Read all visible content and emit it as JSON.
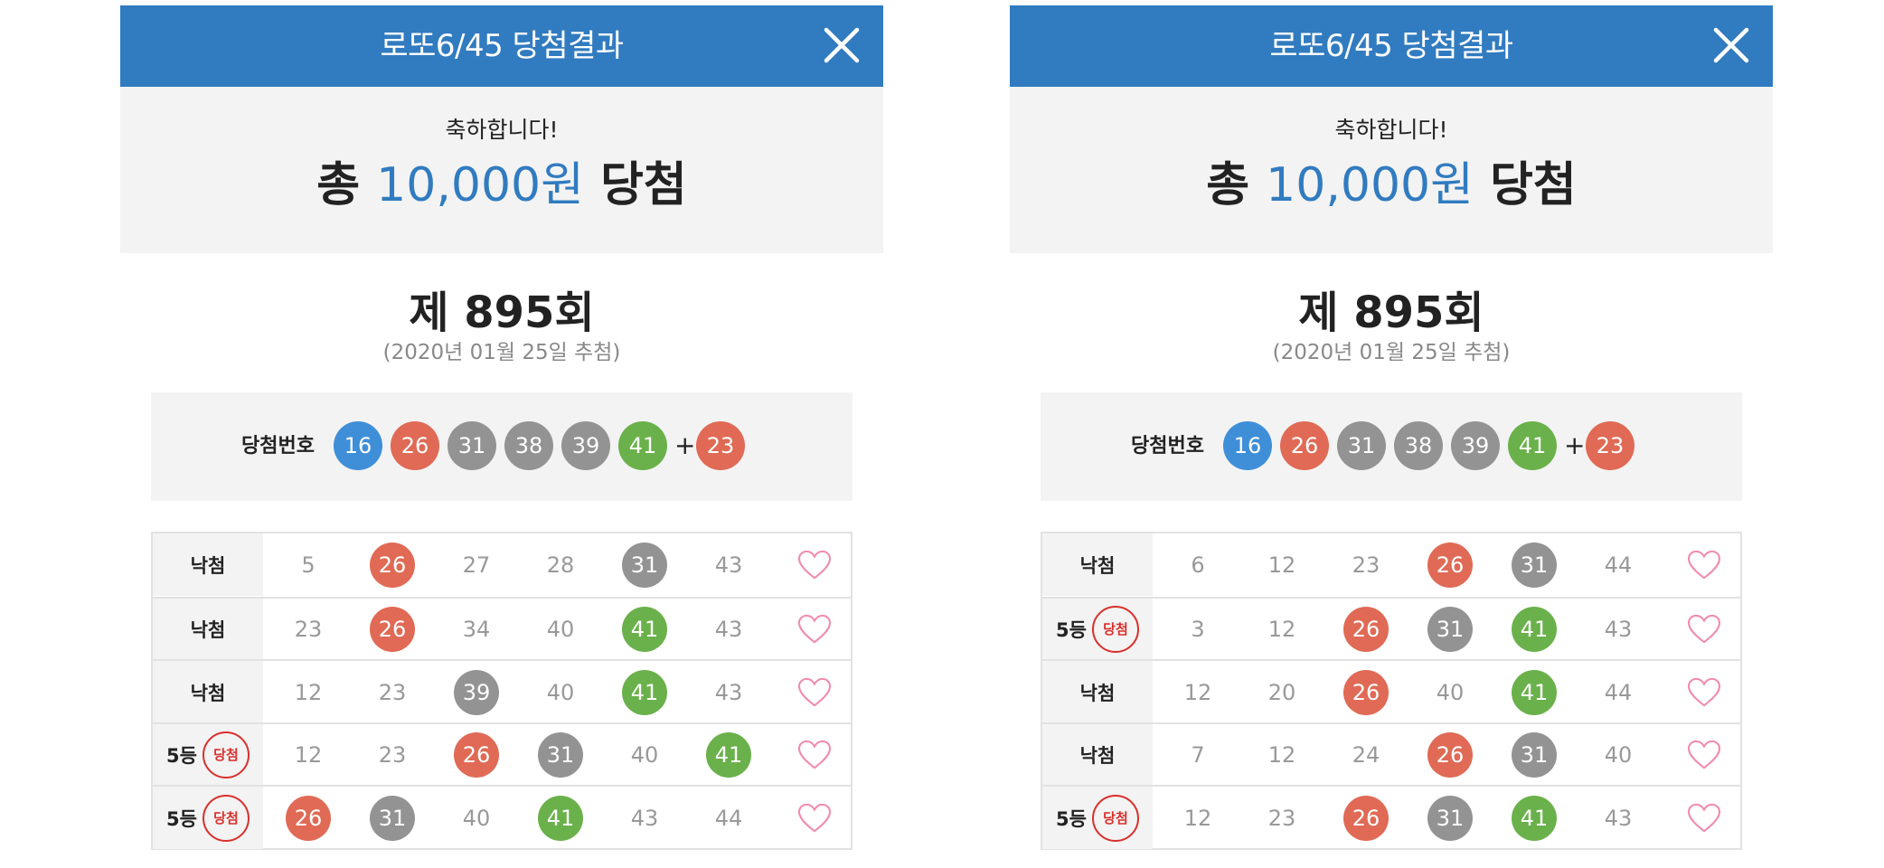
{
  "panels": [
    {
      "header_title": "로또6/45 당첨결과",
      "congrats": {
        "sub": "축하합니다!",
        "prefix": "총 ",
        "amount": "10,000원",
        "suffix": " 당첨"
      },
      "round": "제 895회",
      "draw_date": "(2020년 01월 25일 추첨)",
      "winning": {
        "label": "당첨번호",
        "numbers": [
          {
            "n": "16",
            "color": "blue"
          },
          {
            "n": "26",
            "color": "red"
          },
          {
            "n": "31",
            "color": "gray"
          },
          {
            "n": "38",
            "color": "gray"
          },
          {
            "n": "39",
            "color": "gray"
          },
          {
            "n": "41",
            "color": "green"
          }
        ],
        "plus": "+",
        "bonus": {
          "n": "23",
          "color": "red"
        }
      },
      "rows": [
        {
          "result": "낙첨",
          "rank": "",
          "badge": "",
          "numbers": [
            {
              "n": "5",
              "match": false
            },
            {
              "n": "26",
              "match": true,
              "color": "red"
            },
            {
              "n": "27",
              "match": false
            },
            {
              "n": "28",
              "match": false
            },
            {
              "n": "31",
              "match": true,
              "color": "gray"
            },
            {
              "n": "43",
              "match": false
            }
          ]
        },
        {
          "result": "낙첨",
          "rank": "",
          "badge": "",
          "numbers": [
            {
              "n": "23",
              "match": false
            },
            {
              "n": "26",
              "match": true,
              "color": "red"
            },
            {
              "n": "34",
              "match": false
            },
            {
              "n": "40",
              "match": false
            },
            {
              "n": "41",
              "match": true,
              "color": "green"
            },
            {
              "n": "43",
              "match": false
            }
          ]
        },
        {
          "result": "낙첨",
          "rank": "",
          "badge": "",
          "numbers": [
            {
              "n": "12",
              "match": false
            },
            {
              "n": "23",
              "match": false
            },
            {
              "n": "39",
              "match": true,
              "color": "gray"
            },
            {
              "n": "40",
              "match": false
            },
            {
              "n": "41",
              "match": true,
              "color": "green"
            },
            {
              "n": "43",
              "match": false
            }
          ]
        },
        {
          "result": "",
          "rank": "5등",
          "badge": "당첨",
          "numbers": [
            {
              "n": "12",
              "match": false
            },
            {
              "n": "23",
              "match": false
            },
            {
              "n": "26",
              "match": true,
              "color": "red"
            },
            {
              "n": "31",
              "match": true,
              "color": "gray"
            },
            {
              "n": "40",
              "match": false
            },
            {
              "n": "41",
              "match": true,
              "color": "green"
            }
          ]
        },
        {
          "result": "",
          "rank": "5등",
          "badge": "당첨",
          "numbers": [
            {
              "n": "26",
              "match": true,
              "color": "red"
            },
            {
              "n": "31",
              "match": true,
              "color": "gray"
            },
            {
              "n": "40",
              "match": false
            },
            {
              "n": "41",
              "match": true,
              "color": "green"
            },
            {
              "n": "43",
              "match": false
            },
            {
              "n": "44",
              "match": false
            }
          ]
        }
      ]
    },
    {
      "header_title": "로또6/45 당첨결과",
      "congrats": {
        "sub": "축하합니다!",
        "prefix": "총 ",
        "amount": "10,000원",
        "suffix": " 당첨"
      },
      "round": "제 895회",
      "draw_date": "(2020년 01월 25일 추첨)",
      "winning": {
        "label": "당첨번호",
        "numbers": [
          {
            "n": "16",
            "color": "blue"
          },
          {
            "n": "26",
            "color": "red"
          },
          {
            "n": "31",
            "color": "gray"
          },
          {
            "n": "38",
            "color": "gray"
          },
          {
            "n": "39",
            "color": "gray"
          },
          {
            "n": "41",
            "color": "green"
          }
        ],
        "plus": "+",
        "bonus": {
          "n": "23",
          "color": "red"
        }
      },
      "rows": [
        {
          "result": "낙첨",
          "rank": "",
          "badge": "",
          "numbers": [
            {
              "n": "6",
              "match": false
            },
            {
              "n": "12",
              "match": false
            },
            {
              "n": "23",
              "match": false
            },
            {
              "n": "26",
              "match": true,
              "color": "red"
            },
            {
              "n": "31",
              "match": true,
              "color": "gray"
            },
            {
              "n": "44",
              "match": false
            }
          ]
        },
        {
          "result": "",
          "rank": "5등",
          "badge": "당첨",
          "numbers": [
            {
              "n": "3",
              "match": false
            },
            {
              "n": "12",
              "match": false
            },
            {
              "n": "26",
              "match": true,
              "color": "red"
            },
            {
              "n": "31",
              "match": true,
              "color": "gray"
            },
            {
              "n": "41",
              "match": true,
              "color": "green"
            },
            {
              "n": "43",
              "match": false
            }
          ]
        },
        {
          "result": "낙첨",
          "rank": "",
          "badge": "",
          "numbers": [
            {
              "n": "12",
              "match": false
            },
            {
              "n": "20",
              "match": false
            },
            {
              "n": "26",
              "match": true,
              "color": "red"
            },
            {
              "n": "40",
              "match": false
            },
            {
              "n": "41",
              "match": true,
              "color": "green"
            },
            {
              "n": "44",
              "match": false
            }
          ]
        },
        {
          "result": "낙첨",
          "rank": "",
          "badge": "",
          "numbers": [
            {
              "n": "7",
              "match": false
            },
            {
              "n": "12",
              "match": false
            },
            {
              "n": "24",
              "match": false
            },
            {
              "n": "26",
              "match": true,
              "color": "red"
            },
            {
              "n": "31",
              "match": true,
              "color": "gray"
            },
            {
              "n": "40",
              "match": false
            }
          ]
        },
        {
          "result": "",
          "rank": "5등",
          "badge": "당첨",
          "numbers": [
            {
              "n": "12",
              "match": false
            },
            {
              "n": "23",
              "match": false
            },
            {
              "n": "26",
              "match": true,
              "color": "red"
            },
            {
              "n": "31",
              "match": true,
              "color": "gray"
            },
            {
              "n": "41",
              "match": true,
              "color": "green"
            },
            {
              "n": "43",
              "match": false
            }
          ]
        }
      ]
    }
  ],
  "colors": {
    "header": "#317bc0",
    "blue": "#3f8fd8",
    "red": "#e06a55",
    "gray": "#939393",
    "green": "#6ab14b",
    "badge": "#d9302c",
    "heart": "#f08bb0"
  },
  "icons": {
    "close": "close-icon",
    "heart": "heart-outline-icon"
  }
}
